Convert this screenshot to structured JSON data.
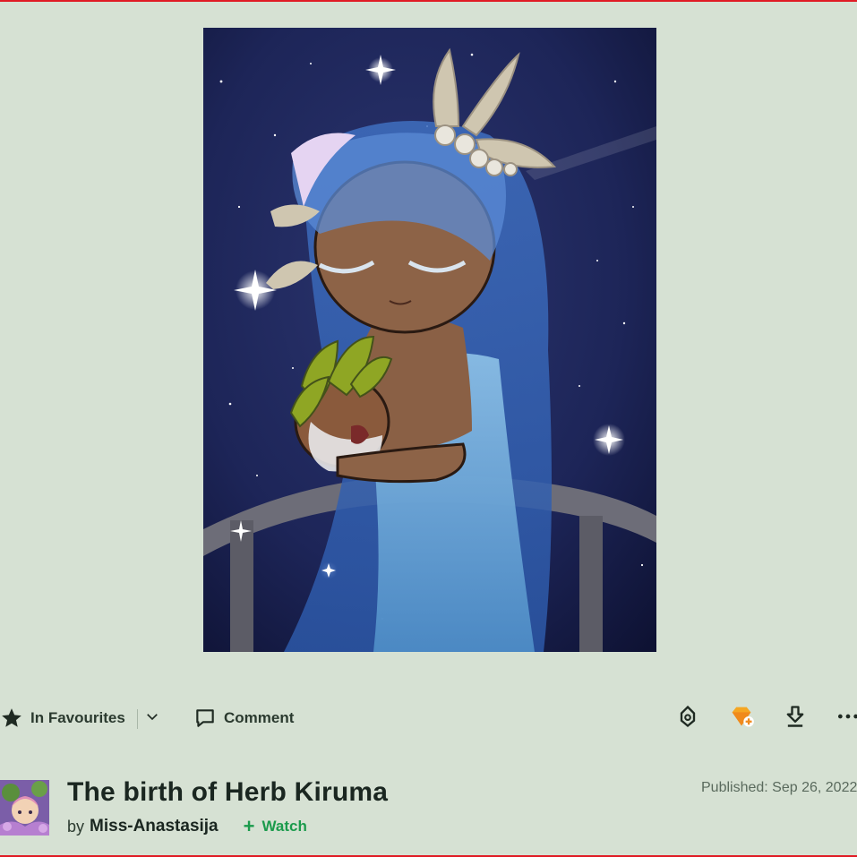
{
  "artwork": {
    "alt": "The birth of Herb Kiruma"
  },
  "actions": {
    "favourite_label": "In Favourites",
    "comment_label": "Comment",
    "icons": [
      "star-icon",
      "chevron-down-icon",
      "comment-icon",
      "badge-icon",
      "gem-icon",
      "download-icon",
      "more-icon"
    ]
  },
  "deviation": {
    "title": "The birth of Herb Kiruma",
    "by_prefix": "by",
    "author": "Miss-Anastasija",
    "watch_plus": "+",
    "watch_label": "Watch",
    "published": "Published: Sep 26, 2022"
  },
  "colors": {
    "page_bg": "#d6e1d3",
    "accent_green": "#1b9b4c",
    "frame_red": "#e01b24",
    "gem_orange": "#f5a623"
  }
}
